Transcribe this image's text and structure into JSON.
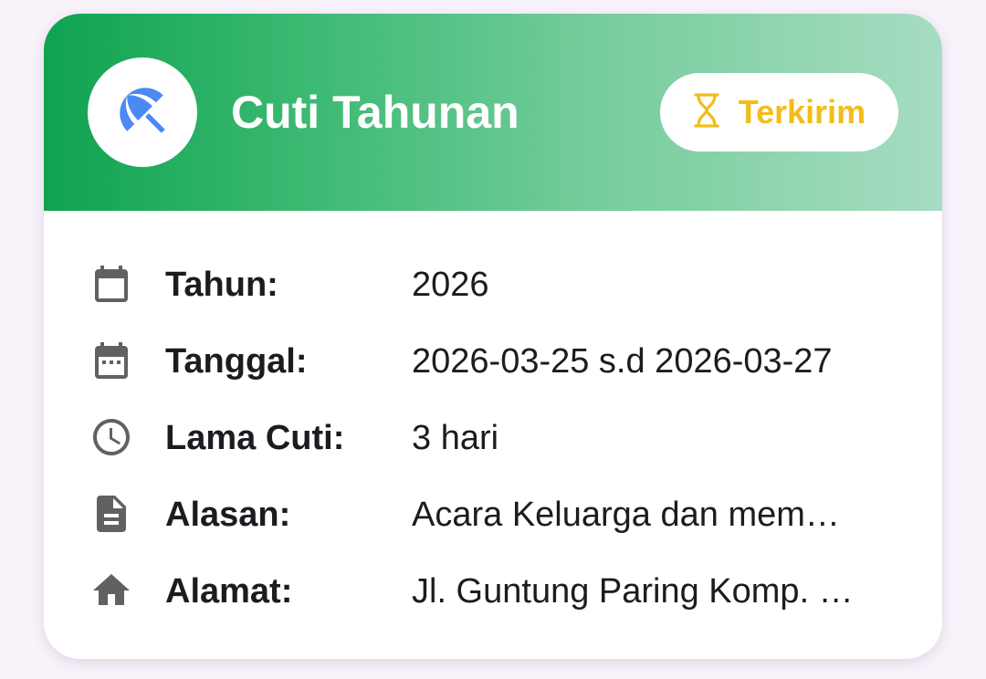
{
  "header": {
    "title": "Cuti Tahunan",
    "icon": "beach-umbrella-icon",
    "status": {
      "label": "Terkirim",
      "icon": "hourglass-icon",
      "color": "#f2bd19"
    }
  },
  "details": {
    "year": {
      "icon": "calendar-icon",
      "label": "Tahun:",
      "value": "2026"
    },
    "dates": {
      "icon": "calendar-month-icon",
      "label": "Tanggal:",
      "value": "2026-03-25 s.d 2026-03-27"
    },
    "duration": {
      "icon": "clock-icon",
      "label": "Lama Cuti:",
      "value": "3 hari"
    },
    "reason": {
      "icon": "document-icon",
      "label": "Alasan:",
      "value": "Acara Keluarga dan mem…"
    },
    "address": {
      "icon": "home-icon",
      "label": "Alamat:",
      "value": "Jl. Guntung Paring Komp. …"
    }
  },
  "colors": {
    "accent_green": "#0fa350",
    "status_yellow": "#f2bd19",
    "umbrella_blue": "#4a8af4",
    "icon_gray": "#616161",
    "background": "#f8f2fa"
  }
}
